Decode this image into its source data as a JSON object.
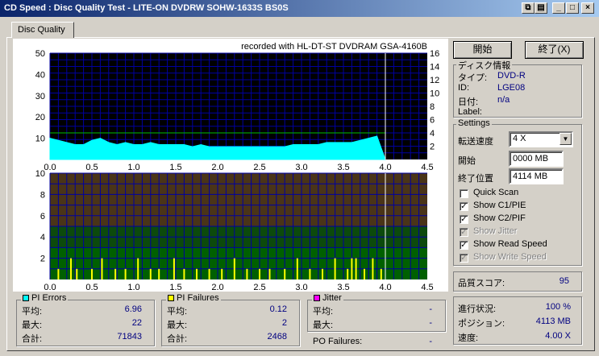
{
  "window": {
    "title": "CD Speed : Disc Quality Test - LITE-ON DVDRW SOHW-1633S BS0S",
    "btn_restore": "⧉",
    "btn_min": "_",
    "btn_max": "□",
    "btn_close": "×"
  },
  "tabs": [
    {
      "label": "Disc Quality"
    }
  ],
  "chart_header": "recorded with HL-DT-ST DVDRAM GSA-4160B",
  "buttons": {
    "start": "開始",
    "exit": "終了(X)"
  },
  "disc_info": {
    "title": "ディスク情報",
    "type_label": "タイプ:",
    "type_value": "DVD-R",
    "id_label": "ID:",
    "id_value": "LGE08",
    "date_label": "日付:",
    "date_value": "n/a",
    "label_label": "Label:",
    "label_value": ""
  },
  "settings": {
    "title": "Settings",
    "speed_label": "転送速度",
    "speed_value": "4 X",
    "start_label": "開始",
    "start_value": "0000 MB",
    "end_label": "終了位置",
    "end_value": "4114 MB",
    "checkboxes": [
      {
        "label": "Quick Scan",
        "checked": false,
        "disabled": false
      },
      {
        "label": "Show C1/PIE",
        "checked": true,
        "disabled": false
      },
      {
        "label": "Show C2/PIF",
        "checked": true,
        "disabled": false
      },
      {
        "label": "Show Jitter",
        "checked": true,
        "disabled": true
      },
      {
        "label": "Show Read Speed",
        "checked": true,
        "disabled": false
      },
      {
        "label": "Show Write Speed",
        "checked": true,
        "disabled": true
      }
    ]
  },
  "quality": {
    "label": "品質スコア:",
    "value": "95"
  },
  "progress": {
    "progress_label": "進行状況:",
    "progress_value": "100 %",
    "position_label": "ポジション:",
    "position_value": "4113 MB",
    "speed_label": "速度:",
    "speed_value": "4.00 X"
  },
  "pi_errors": {
    "title": "PI Errors",
    "color": "#00ffff",
    "avg_label": "平均:",
    "avg": "6.96",
    "max_label": "最大:",
    "max": "22",
    "total_label": "合計:",
    "total": "71843"
  },
  "pi_failures": {
    "title": "PI Failures",
    "color": "#ffff00",
    "avg_label": "平均:",
    "avg": "0.12",
    "max_label": "最大:",
    "max": "2",
    "total_label": "合計:",
    "total": "2468"
  },
  "jitter": {
    "title": "Jitter",
    "color": "#ff00ff",
    "avg_label": "平均:",
    "avg": "-",
    "max_label": "最大:",
    "max": "-"
  },
  "po_failures": {
    "label": "PO Failures:",
    "value": "-"
  },
  "chart_data": [
    {
      "type": "area",
      "title": "recorded with HL-DT-ST DVDRAM GSA-4160B",
      "xlim": [
        0,
        4.5
      ],
      "ylim": [
        0,
        50
      ],
      "ylim_right": [
        0,
        16
      ],
      "x_ticks": [
        "0.0",
        "0.5",
        "1.0",
        "1.5",
        "2.0",
        "2.5",
        "3.0",
        "3.5",
        "4.0",
        "4.5"
      ],
      "y_ticks": [
        "10",
        "20",
        "30",
        "40",
        "50"
      ],
      "y_ticks_right": [
        "2",
        "4",
        "6",
        "8",
        "10",
        "12",
        "14",
        "16"
      ],
      "grid": true,
      "series": [
        {
          "name": "PI Errors",
          "color": "#00ffff",
          "x": [
            0.0,
            0.1,
            0.2,
            0.3,
            0.4,
            0.5,
            0.6,
            0.7,
            0.8,
            0.9,
            1.0,
            1.1,
            1.2,
            1.3,
            1.4,
            1.5,
            1.6,
            1.7,
            1.8,
            1.9,
            2.0,
            2.1,
            2.2,
            2.3,
            2.4,
            2.5,
            2.6,
            2.7,
            2.8,
            2.9,
            3.0,
            3.1,
            3.2,
            3.3,
            3.4,
            3.5,
            3.6,
            3.7,
            3.8,
            3.9,
            4.0
          ],
          "values": [
            10,
            9,
            8,
            7,
            7,
            9,
            10,
            8,
            7,
            8,
            7,
            7,
            8,
            7,
            7,
            7,
            7,
            6,
            7,
            6,
            6,
            6,
            6,
            6,
            6,
            6,
            6,
            6,
            6,
            7,
            7,
            7,
            7,
            8,
            8,
            8,
            8,
            9,
            10,
            11,
            0
          ]
        },
        {
          "name": "Read Speed",
          "color": "#00c000",
          "x": [
            0.0,
            0.5,
            1.0,
            1.5,
            2.0,
            2.5,
            3.0,
            3.5,
            4.0
          ],
          "values": [
            4.0,
            4.0,
            4.0,
            4.0,
            4.0,
            4.0,
            4.0,
            4.0,
            4.0
          ]
        }
      ]
    },
    {
      "type": "bar",
      "xlim": [
        0,
        4.5
      ],
      "ylim": [
        0,
        10
      ],
      "x_ticks": [
        "0.0",
        "0.5",
        "1.0",
        "1.5",
        "2.0",
        "2.5",
        "3.0",
        "3.5",
        "4.0",
        "4.5"
      ],
      "y_ticks": [
        "2",
        "4",
        "6",
        "8",
        "10"
      ],
      "grid": true,
      "series": [
        {
          "name": "PI Failures",
          "color": "#ffff00",
          "x": [
            0.1,
            0.25,
            0.32,
            0.5,
            0.62,
            0.78,
            0.9,
            1.05,
            1.2,
            1.3,
            1.48,
            1.6,
            1.75,
            1.9,
            2.05,
            2.2,
            2.35,
            2.5,
            2.62,
            2.8,
            2.95,
            3.1,
            3.25,
            3.4,
            3.55,
            3.6,
            3.65,
            3.75,
            3.85,
            3.95
          ],
          "values": [
            1,
            2,
            1,
            1,
            2,
            1,
            1,
            2,
            1,
            1,
            2,
            1,
            1,
            1,
            1,
            2,
            1,
            1,
            1,
            1,
            2,
            1,
            1,
            2,
            1,
            2,
            2,
            1,
            2,
            1
          ]
        }
      ]
    }
  ]
}
